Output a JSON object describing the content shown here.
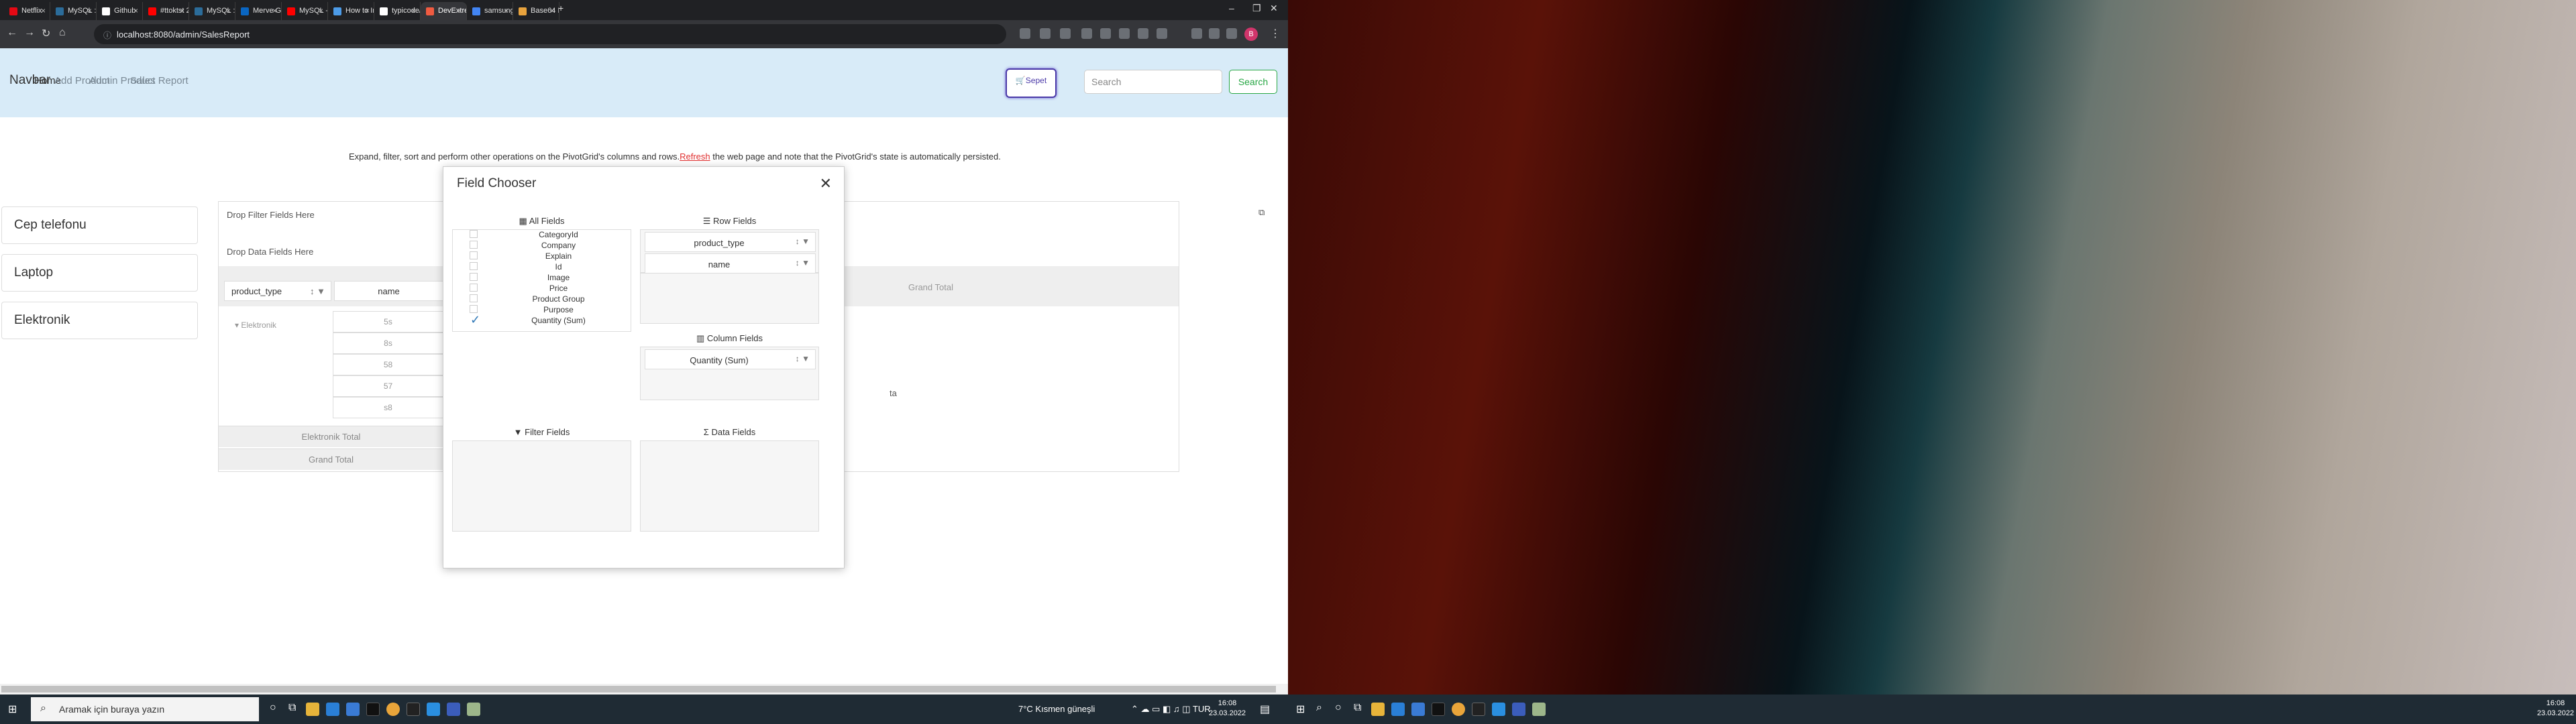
{
  "browser": {
    "tabs": [
      {
        "label": "Netflix",
        "color": "#e50914"
      },
      {
        "label": "MySQL :: Be...",
        "color": "#2b6c9a"
      },
      {
        "label": "Github",
        "color": "#ffffff"
      },
      {
        "label": "#ttoktst 2011",
        "color": "#ff0000"
      },
      {
        "label": "MySQL :: Be...",
        "color": "#2b6c9a"
      },
      {
        "label": "Merve G. aca",
        "color": "#0a66c2"
      },
      {
        "label": "MySQL - 00",
        "color": "#ff0000"
      },
      {
        "label": "How to Insta",
        "color": "#4c9be8"
      },
      {
        "label": "typicode/jsc",
        "color": "#ffffff"
      },
      {
        "label": "DevExtreme",
        "color": "#f05b41"
      },
      {
        "label": "samsung ol.",
        "color": "#4285f4"
      },
      {
        "label": "Base64 Imag",
        "color": "#e8a33d"
      }
    ],
    "url": "localhost:8080/admin/SalesReport"
  },
  "site": {
    "brand": "Navbar",
    "links": [
      "Home",
      "Add Product",
      "Admin Product",
      "Sales Report"
    ],
    "cart_label": "Sepet",
    "search_placeholder": "Search",
    "search_button": "Search",
    "info_before": "Expand, filter, sort and perform other operations on the PivotGrid's columns and rows.",
    "info_link": "Refresh",
    "info_after": " the web page and note that the PivotGrid's state is automatically persisted.",
    "categories": [
      "Cep telefonu",
      "Laptop",
      "Elektronik"
    ]
  },
  "pivot": {
    "filter_drop": "Drop Filter Fields Here",
    "data_drop": "Drop Data Fields Here",
    "row_headers": [
      "product_type",
      "name"
    ],
    "group": "Elektronik",
    "row_cells": [
      "5s",
      "8s",
      "58",
      "57",
      "s8"
    ],
    "group_total": "Elektronik Total",
    "grand_total": "Grand Total",
    "col_grand_total": "Grand Total",
    "partial_text": "ta"
  },
  "field_chooser": {
    "title": "Field Chooser",
    "all_fields_title": "All Fields",
    "row_fields_title": "Row Fields",
    "column_fields_title": "Column Fields",
    "filter_fields_title": "Filter Fields",
    "data_fields_title": "Data Fields",
    "all_fields": [
      {
        "label": "CategoryId",
        "checked": false
      },
      {
        "label": "Company",
        "checked": false
      },
      {
        "label": "Explain",
        "checked": false
      },
      {
        "label": "Id",
        "checked": false
      },
      {
        "label": "Image",
        "checked": false
      },
      {
        "label": "Price",
        "checked": false
      },
      {
        "label": "Product Group",
        "checked": false
      },
      {
        "label": "Purpose",
        "checked": false
      },
      {
        "label": "Quantity (Sum)",
        "checked": true
      }
    ],
    "row_fields": [
      "product_type",
      "name"
    ],
    "column_fields": [
      "Quantity (Sum)"
    ]
  },
  "taskbar": {
    "search_placeholder": "Aramak için buraya yazın",
    "weather": "7°C  Kısmen güneşli",
    "time": "16:08",
    "date": "23.03.2022"
  }
}
